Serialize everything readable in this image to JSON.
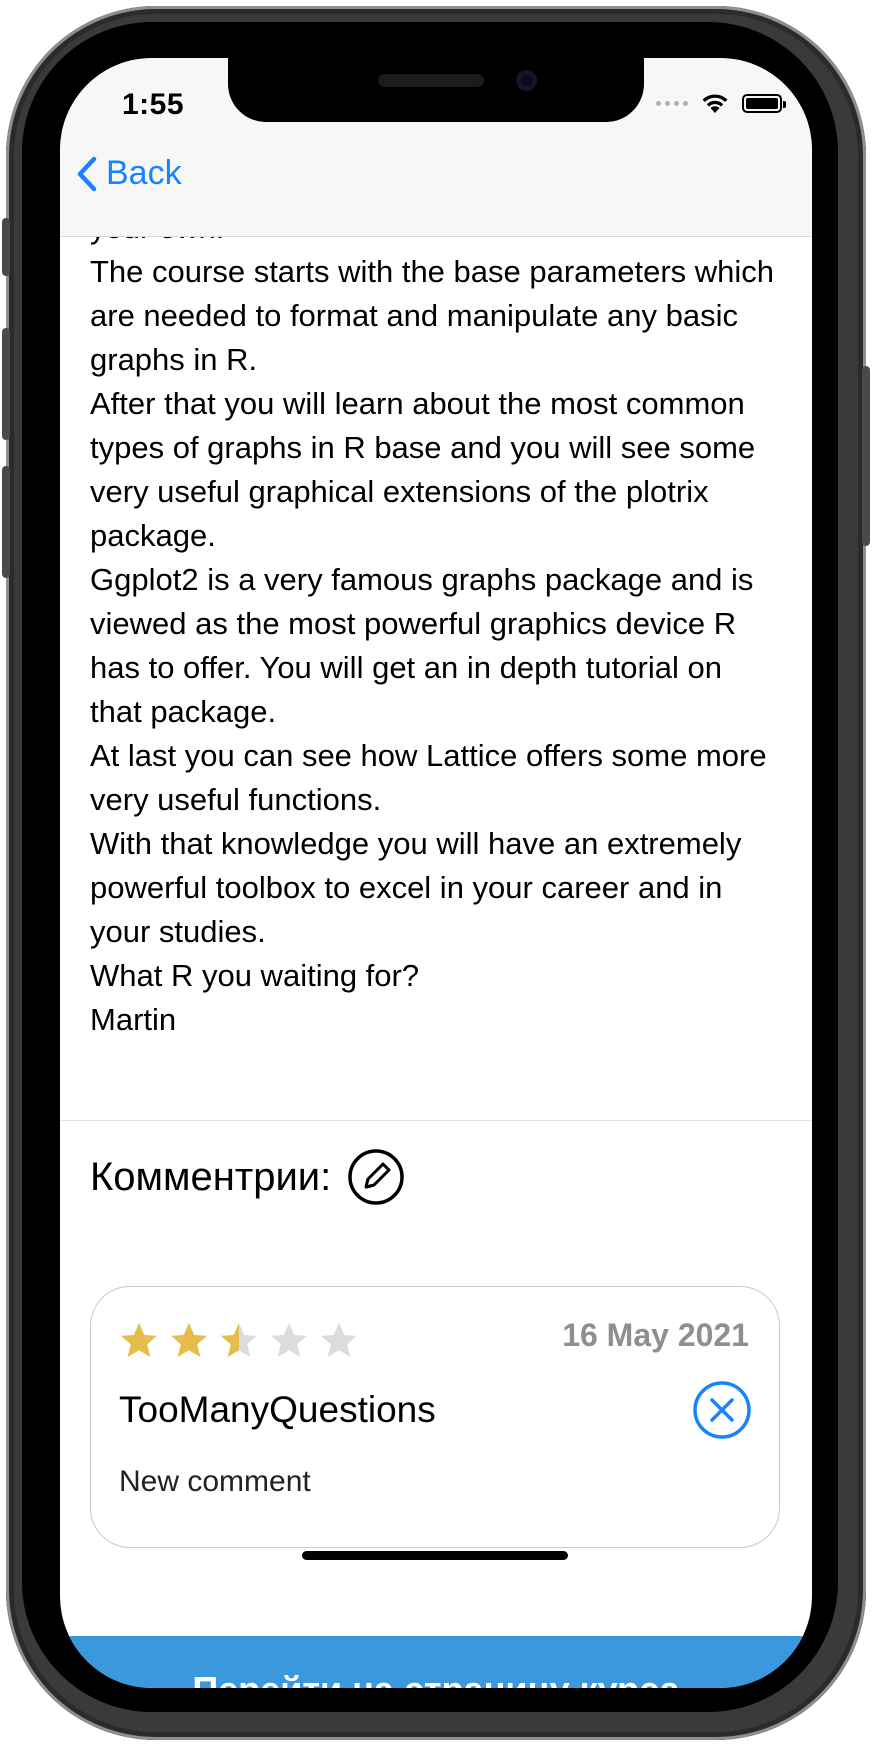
{
  "status_bar": {
    "time": "1:55"
  },
  "nav": {
    "back_label": "Back"
  },
  "description": {
    "text": "your own.\n The course starts with the base parameters which are needed to format and manipulate any basic graphs in R.\n After that you will learn about the most common types of graphs in R base and you will see some very useful graphical extensions of the plotrix package.\n Ggplot2 is a very famous graphs package and is viewed as the most powerful graphics device R has to offer. You will get an in depth tutorial on that package.\n At last you can see how Lattice offers some more very useful functions.\n With that knowledge you will have an extremely powerful toolbox to excel in your career and in your studies.\n What R you waiting for?\n Martin"
  },
  "comments": {
    "title": "Комментрии:",
    "items": [
      {
        "rating": 2.5,
        "max_rating": 5,
        "date": "16 May 2021",
        "author": "TooManyQuestions",
        "text": "New comment"
      }
    ]
  },
  "footer": {
    "course_button_label": "Перейти на страницу курса"
  },
  "colors": {
    "accent": "#1a82ff",
    "star_filled": "#e6bc4a",
    "star_empty": "#dcdcdc",
    "button_bg": "#3b98dd"
  }
}
